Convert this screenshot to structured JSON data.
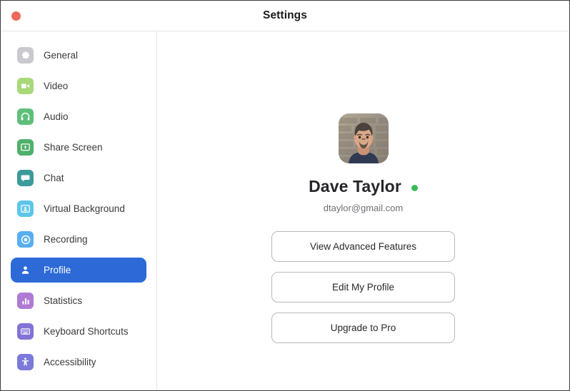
{
  "window": {
    "title": "Settings",
    "close_button_color": "#eb6a5d",
    "accent_color": "#2d6ad8"
  },
  "sidebar": {
    "items": [
      {
        "label": "General",
        "icon": "gear-icon",
        "icon_bg": "#c9c9cf",
        "selected": false
      },
      {
        "label": "Video",
        "icon": "video-camera-icon",
        "icon_bg": "#a8d879",
        "selected": false
      },
      {
        "label": "Audio",
        "icon": "headphones-icon",
        "icon_bg": "#5fbf7a",
        "selected": false
      },
      {
        "label": "Share Screen",
        "icon": "share-screen-icon",
        "icon_bg": "#4fb06a",
        "selected": false
      },
      {
        "label": "Chat",
        "icon": "chat-bubble-icon",
        "icon_bg": "#3c9a9a",
        "selected": false
      },
      {
        "label": "Virtual Background",
        "icon": "virtual-background-icon",
        "icon_bg": "#5ec6e8",
        "selected": false
      },
      {
        "label": "Recording",
        "icon": "record-circle-icon",
        "icon_bg": "#58aef0",
        "selected": false
      },
      {
        "label": "Profile",
        "icon": "person-icon",
        "icon_bg": "#2d6ad8",
        "selected": true
      },
      {
        "label": "Statistics",
        "icon": "bar-chart-icon",
        "icon_bg": "#b07ad4",
        "selected": false
      },
      {
        "label": "Keyboard Shortcuts",
        "icon": "keyboard-icon",
        "icon_bg": "#8273d6",
        "selected": false
      },
      {
        "label": "Accessibility",
        "icon": "accessibility-icon",
        "icon_bg": "#7b79d9",
        "selected": false
      }
    ]
  },
  "profile": {
    "avatar_alt": "user-profile-photo",
    "name": "Dave Taylor",
    "status": "online",
    "status_color": "#3cb95a",
    "email": "dtaylor@gmail.com",
    "buttons": [
      {
        "label": "View Advanced Features"
      },
      {
        "label": "Edit My Profile"
      },
      {
        "label": "Upgrade to Pro"
      }
    ]
  }
}
